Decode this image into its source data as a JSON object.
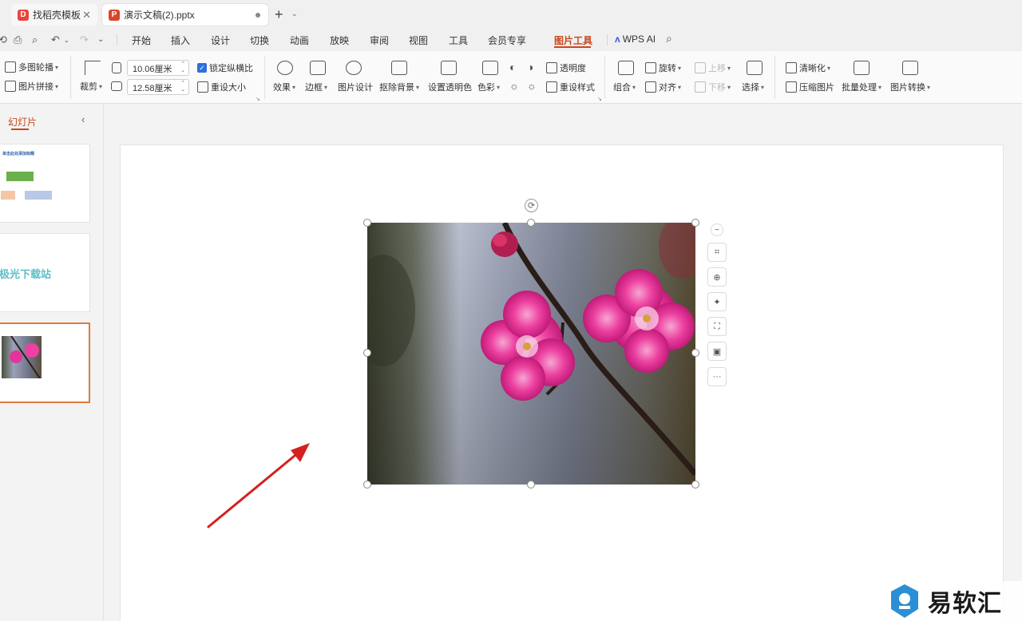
{
  "tabs": [
    {
      "label": "找稻壳模板",
      "logo": "D",
      "color": "#e8453c"
    },
    {
      "label": "演示文稿(2).pptx",
      "logo": "P",
      "color": "#d9462b"
    }
  ],
  "menu": [
    "开始",
    "插入",
    "设计",
    "切换",
    "动画",
    "放映",
    "审阅",
    "视图",
    "工具",
    "会员专享",
    "图片工具"
  ],
  "active_menu": "图片工具",
  "wps_ai": "WPS AI",
  "ribbon": {
    "multi_carousel": "多图轮播",
    "picture_collage": "图片拼接",
    "crop": "裁剪",
    "width_value": "10.06厘米",
    "height_value": "12.58厘米",
    "lock_ratio": "锁定纵横比",
    "reset_size": "重设大小",
    "effects": "效果",
    "border": "边框",
    "picture_design": "图片设计",
    "remove_bg": "抠除背景",
    "set_transparent": "设置透明色",
    "color": "色彩",
    "transparency": "透明度",
    "reset_style": "重设样式",
    "group": "组合",
    "rotate": "旋转",
    "align": "对齐",
    "bring_forward": "上移",
    "send_backward": "下移",
    "select": "选择",
    "sharpen": "清晰化",
    "compress": "压缩图片",
    "batch": "批量处理",
    "convert": "图片转换"
  },
  "left_panel": {
    "title": "幻灯片",
    "slide1_title": "单击此处添加标题",
    "slide2_text": "极光下载站"
  },
  "watermark": "易软汇",
  "colors": {
    "accent": "#c8481d",
    "selection": "#e07a3d",
    "arrow": "#d42020"
  }
}
